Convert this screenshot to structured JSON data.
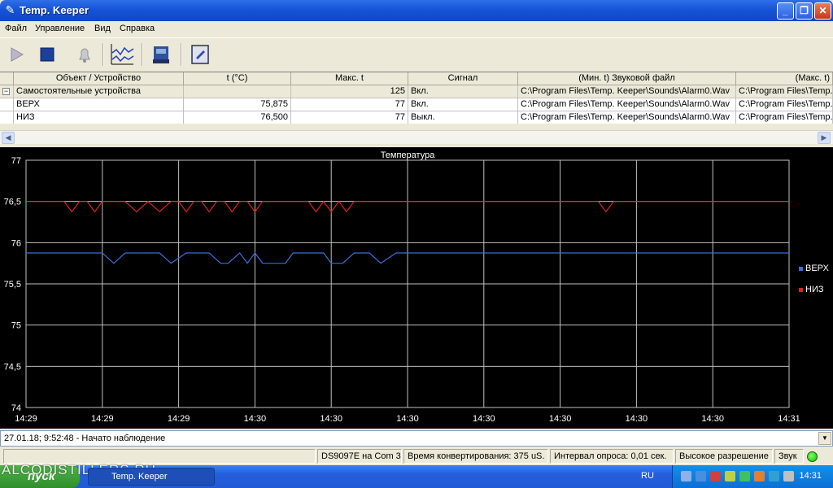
{
  "window": {
    "title": "Temp. Keeper",
    "minimize": "_",
    "maximize": "❐",
    "close": "✕"
  },
  "menu": [
    "Файл",
    "Управление",
    "Вид",
    "Справка"
  ],
  "toolbar": {
    "icons": [
      "play-icon",
      "stop-icon",
      "bell-icon",
      "chart-icon",
      "device-icon",
      "settings-icon"
    ]
  },
  "table": {
    "columns": [
      "Объект / Устройство",
      "t (°C)",
      "Макс. t",
      "Сигнал",
      "(Мин. t) Звуковой файл",
      "(Макс. t)"
    ],
    "group": {
      "name": "Самостоятельные устройства",
      "expander": "−",
      "t": "",
      "max_t": "125",
      "signal": "Вкл.",
      "min_file": "C:\\Program Files\\Temp. Keeper\\Sounds\\Alarm0.Wav",
      "max_file": "C:\\Program Files\\Temp."
    },
    "rows": [
      {
        "name": "ВЕРХ",
        "t": "75,875",
        "max_t": "77",
        "signal": "Вкл.",
        "min_file": "C:\\Program Files\\Temp. Keeper\\Sounds\\Alarm0.Wav",
        "max_file": "C:\\Program Files\\Temp."
      },
      {
        "name": "НИЗ",
        "t": "76,500",
        "max_t": "77",
        "signal": "Выкл.",
        "min_file": "C:\\Program Files\\Temp. Keeper\\Sounds\\Alarm0.Wav",
        "max_file": "C:\\Program Files\\Temp."
      }
    ]
  },
  "chart_data": {
    "type": "line",
    "title": "Температура",
    "xlabel": "",
    "ylabel": "",
    "ylim": [
      74,
      77
    ],
    "xlim": [
      0,
      10
    ],
    "y_ticks": [
      "77",
      "76,5",
      "76",
      "75,5",
      "75",
      "74,5",
      "74"
    ],
    "y_tick_values": [
      77,
      76.5,
      76,
      75.5,
      75,
      74.5,
      74
    ],
    "x_ticks": [
      "14:29",
      "14:29",
      "14:29",
      "14:30",
      "14:30",
      "14:30",
      "14:30",
      "14:30",
      "14:30",
      "14:30",
      "14:31"
    ],
    "grid": true,
    "legend_position": "right",
    "background": "#000000",
    "grid_color": "#c0c0c0",
    "series": [
      {
        "name": "ВЕРХ",
        "color": "#3a6ee0",
        "x": [
          0,
          1.0,
          1.15,
          1.3,
          1.6,
          1.75,
          1.9,
          2.1,
          2.3,
          2.4,
          2.55,
          2.65,
          2.8,
          2.9,
          3.0,
          3.1,
          3.3,
          3.4,
          3.5,
          3.9,
          4.0,
          4.15,
          4.3,
          4.5,
          4.65,
          4.85,
          10
        ],
        "y": [
          75.875,
          75.875,
          75.75,
          75.875,
          75.875,
          75.875,
          75.75,
          75.875,
          75.875,
          75.875,
          75.75,
          75.75,
          75.875,
          75.75,
          75.875,
          75.75,
          75.75,
          75.75,
          75.875,
          75.875,
          75.75,
          75.75,
          75.875,
          75.875,
          75.75,
          75.875,
          75.875
        ]
      },
      {
        "name": "НИЗ",
        "color": "#e02020",
        "x": [
          0,
          0.5,
          0.6,
          0.7,
          0.8,
          0.9,
          1.0,
          1.3,
          1.45,
          1.6,
          1.75,
          1.9,
          2.0,
          2.1,
          2.2,
          2.3,
          2.4,
          2.5,
          2.6,
          2.7,
          2.8,
          2.9,
          3.0,
          3.1,
          3.2,
          3.3,
          3.7,
          3.8,
          3.9,
          4.0,
          4.1,
          4.2,
          4.3,
          4.4,
          7.5,
          7.6,
          7.7,
          10
        ],
        "y": [
          76.5,
          76.5,
          76.375,
          76.5,
          76.5,
          76.375,
          76.5,
          76.5,
          76.375,
          76.5,
          76.375,
          76.5,
          76.5,
          76.375,
          76.5,
          76.5,
          76.375,
          76.5,
          76.5,
          76.375,
          76.5,
          76.5,
          76.375,
          76.5,
          76.5,
          76.5,
          76.5,
          76.375,
          76.5,
          76.375,
          76.5,
          76.375,
          76.5,
          76.5,
          76.5,
          76.375,
          76.5,
          76.5
        ]
      }
    ]
  },
  "log": {
    "line": "27.01.18; 9:52:48 - Начато наблюдение"
  },
  "status": {
    "port": "DS9097E на Com 3",
    "conversion": "Время конвертирования: 375 uS.",
    "interval": "Интервал опроса: 0,01 сек.",
    "resolution": "Высокое разрешение",
    "sound": "Звук"
  },
  "taskbar": {
    "start": "пуск",
    "watermark": "ALCODISTILLERS.RU",
    "task": "Temp. Keeper",
    "lang": "RU",
    "clock": "14:31"
  }
}
